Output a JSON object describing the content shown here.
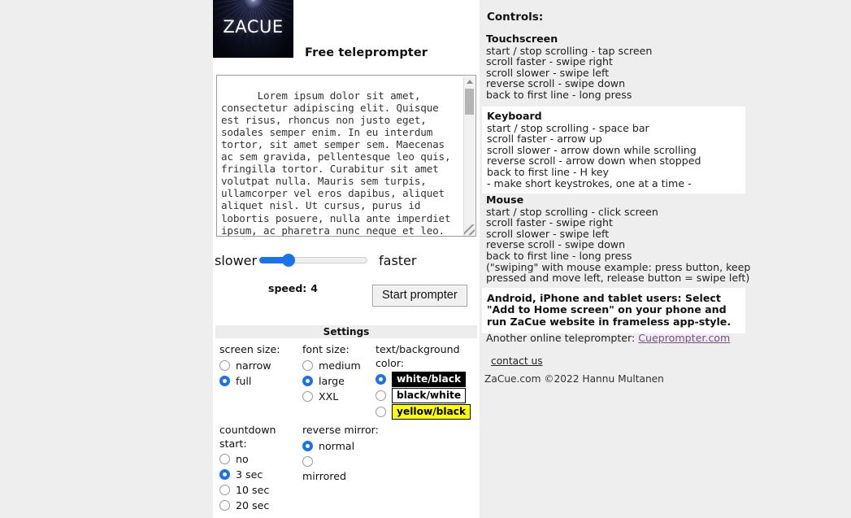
{
  "app": {
    "logo_text": "ZACUE",
    "tagline": "Free teleprompter"
  },
  "editor": {
    "script_text": "Lorem ipsum dolor sit amet, consectetur adipiscing elit. Quisque est risus, rhoncus non justo eget, sodales semper enim. In eu interdum tortor, sit amet semper sem. Maecenas ac sem gravida, pellentesque leo quis, fringilla tortor. Curabitur sit amet volutpat nulla. Mauris sem turpis, ullamcorper vel eros dapibus, aliquet aliquet nisl. Ut cursus, purus id lobortis posuere, nulla ante imperdiet ipsum, ac pharetra nunc neque et leo. Phasellus molestie augue ac dignissim feugiat. Maecenas eu nisl id nisl"
  },
  "speed": {
    "slower_label": "slower",
    "faster_label": "faster",
    "readout_label": "speed:",
    "value": "4",
    "slider_min": "1",
    "slider_max": "15",
    "accent_color": "#1a73e8"
  },
  "actions": {
    "start_label": "Start prompter"
  },
  "settings": {
    "header": "Settings",
    "screen_size": {
      "title": "screen size:",
      "options": [
        {
          "label": "narrow",
          "selected": false
        },
        {
          "label": "full",
          "selected": true
        }
      ]
    },
    "font_size": {
      "title": "font size:",
      "options": [
        {
          "label": "medium",
          "selected": false
        },
        {
          "label": "large",
          "selected": true
        },
        {
          "label": "XXL",
          "selected": false
        }
      ]
    },
    "color": {
      "title": "text/background color:",
      "options": [
        {
          "label": "white/black",
          "selected": true,
          "fg": "#ffffff",
          "bg": "#000000"
        },
        {
          "label": "black/white",
          "selected": false,
          "fg": "#000000",
          "bg": "#ffffff"
        },
        {
          "label": "yellow/black",
          "selected": false,
          "fg": "#000000",
          "bg": "#ffff00"
        }
      ]
    },
    "countdown": {
      "title": "countdown start:",
      "options": [
        {
          "label": "no",
          "selected": false
        },
        {
          "label": "3 sec",
          "selected": true
        },
        {
          "label": "10 sec",
          "selected": false
        },
        {
          "label": "20 sec",
          "selected": false
        }
      ]
    },
    "mirror": {
      "title": "reverse mirror:",
      "options": [
        {
          "label": "normal",
          "selected": true
        },
        {
          "label": "mirrored",
          "selected": false
        }
      ]
    }
  },
  "controls": {
    "title": "Controls:",
    "touchscreen": {
      "heading": "Touchscreen",
      "lines": [
        "start / stop scrolling - tap screen",
        "scroll faster - swipe right",
        "scroll slower - swipe left",
        "reverse scroll - swipe down",
        "back to first line - long press"
      ]
    },
    "keyboard": {
      "heading": "Keyboard",
      "lines": [
        "start / stop scrolling - space bar",
        "scroll faster - arrow up",
        "scroll slower - arrow down while scrolling",
        "reverse scroll - arrow down when stopped",
        "back to first line - H key",
        "- make short keystrokes, one at a time -"
      ]
    },
    "mouse": {
      "heading": "Mouse",
      "lines": [
        "start / stop scrolling - click screen",
        "scroll faster - swipe right",
        "scroll slower - swipe left",
        "reverse scroll - swipe down",
        "back to first line - long press",
        "(\"swiping\" with mouse example: press button, keep",
        "pressed and move left, release button = swipe left)"
      ]
    }
  },
  "footer": {
    "note": "Android, iPhone and tablet users: Select \"Add to Home screen\" on your phone and run ZaCue website in frameless app-style.",
    "another_prefix": "Another online teleprompter:",
    "another_link": "Cueprompter.com",
    "contact_label": "contact us",
    "copyright": "ZaCue.com ©2022 Hannu Multanen"
  }
}
